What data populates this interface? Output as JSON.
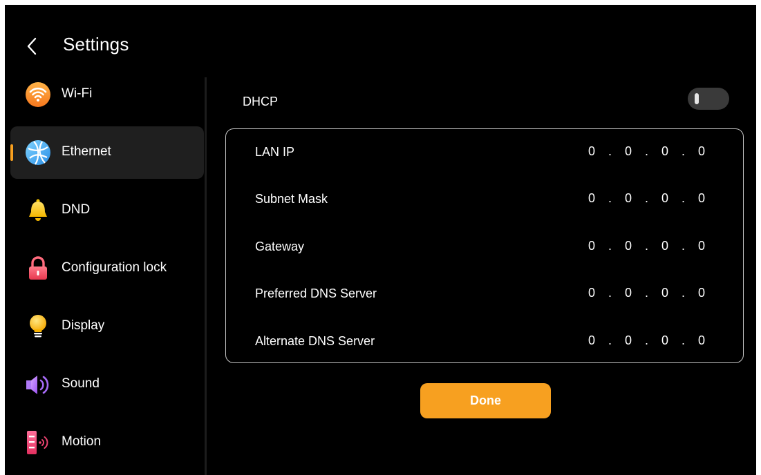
{
  "header": {
    "title": "Settings",
    "back_icon": "chevron-left-icon"
  },
  "sidebar": {
    "items": [
      {
        "label": "Wi-Fi",
        "icon": "wifi-icon",
        "active": false
      },
      {
        "label": "Ethernet",
        "icon": "ethernet-globe-icon",
        "active": true
      },
      {
        "label": "DND",
        "icon": "bell-icon",
        "active": false
      },
      {
        "label": "Configuration lock",
        "icon": "lock-icon",
        "active": false
      },
      {
        "label": "Display",
        "icon": "lightbulb-icon",
        "active": false
      },
      {
        "label": "Sound",
        "icon": "speaker-icon",
        "active": false
      },
      {
        "label": "Motion",
        "icon": "motion-sensor-icon",
        "active": false
      }
    ]
  },
  "ethernet": {
    "dhcp_label": "DHCP",
    "dhcp_enabled": false,
    "rows": [
      {
        "label": "LAN IP",
        "value": "0.0.0.0"
      },
      {
        "label": "Subnet Mask",
        "value": "0.0.0.0"
      },
      {
        "label": "Gateway",
        "value": "0.0.0.0"
      },
      {
        "label": "Preferred DNS Server",
        "value": "0.0.0.0"
      },
      {
        "label": "Alternate DNS Server",
        "value": "0.0.0.0"
      }
    ],
    "done_label": "Done"
  },
  "colors": {
    "accent": "#f7a020",
    "background": "#000000",
    "active_item": "#1f1f1f",
    "panel_border": "#c8c8c8",
    "toggle_off": "#3a3a3a"
  }
}
